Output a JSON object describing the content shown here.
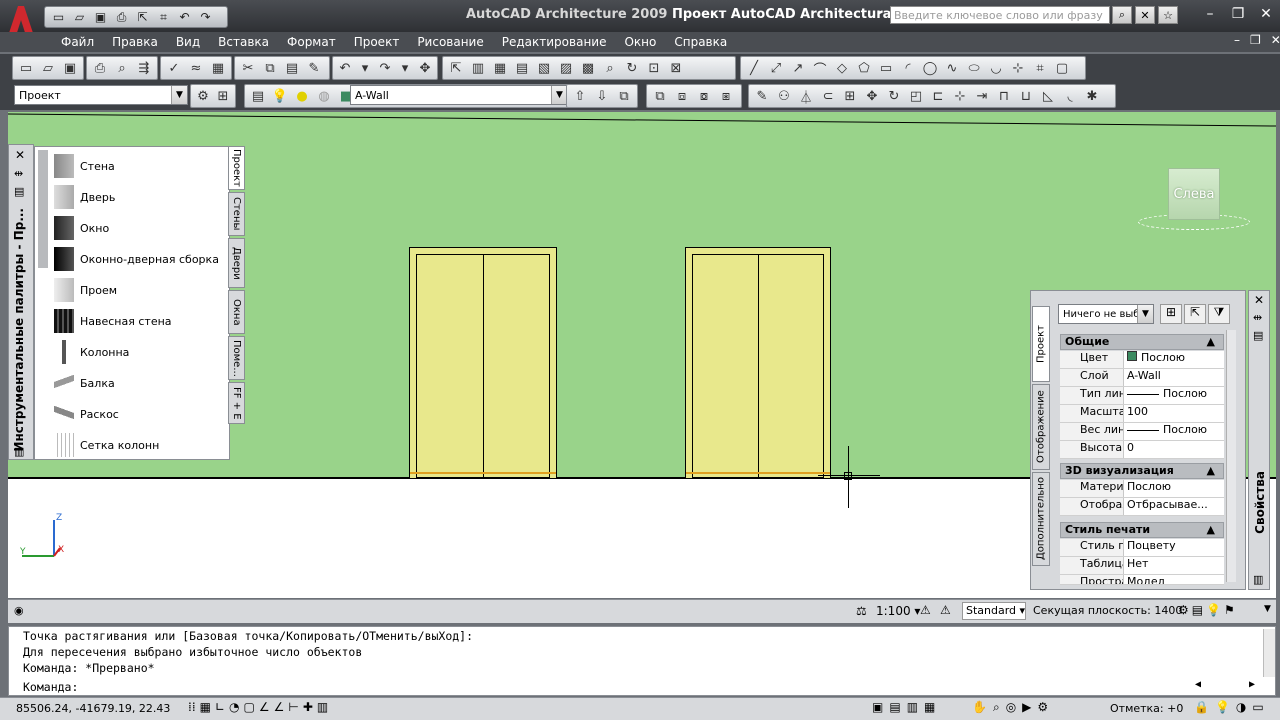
{
  "title_bar": {
    "app_name": "AutoCAD Architecture 2009",
    "document": "Проект AutoCAD Architectural",
    "search_placeholder": "Введите ключевое слово или фразу"
  },
  "menu": [
    "Файл",
    "Правка",
    "Вид",
    "Вставка",
    "Формат",
    "Проект",
    "Рисование",
    "Редактирование",
    "Окно",
    "Справка"
  ],
  "toolbar2": {
    "workspace": "Проект",
    "layer": "A-Wall"
  },
  "viewcube": {
    "label": "Слева"
  },
  "tool_palette": {
    "title": "Инструментальные палитры - Пр...",
    "items": [
      "Стена",
      "Дверь",
      "Окно",
      "Оконно-дверная сборка",
      "Проем",
      "Навесная стена",
      "Колонна",
      "Балка",
      "Раскос",
      "Сетка колонн"
    ],
    "tabs": [
      "Проект",
      "Стены",
      "Двери",
      "Окна",
      "Поме...",
      "FF + E"
    ]
  },
  "properties": {
    "title": "Свойства",
    "selection": "Ничего не выб",
    "tabs": [
      "Проект",
      "Отображение",
      "Дополнительно"
    ],
    "sections": [
      {
        "name": "Общие",
        "rows": [
          {
            "k": "Цвет",
            "v": "Послою"
          },
          {
            "k": "Слой",
            "v": "A-Wall"
          },
          {
            "k": "Тип линий",
            "v": "Послою"
          },
          {
            "k": "Масштаб...",
            "v": "100"
          },
          {
            "k": "Вес линий",
            "v": "Послою"
          },
          {
            "k": "Высота",
            "v": "0"
          }
        ]
      },
      {
        "name": "3D визуализация",
        "rows": [
          {
            "k": "Материал",
            "v": "Послою"
          },
          {
            "k": "Отображ...",
            "v": "Отбрасывае..."
          }
        ]
      },
      {
        "name": "Стиль печати",
        "rows": [
          {
            "k": "Стиль пе...",
            "v": "Поцвету"
          },
          {
            "k": "Таблица ...",
            "v": "Нет"
          },
          {
            "k": "Простра...",
            "v": "Модел"
          }
        ]
      }
    ]
  },
  "status_upper": {
    "scale": "1:100",
    "style": "Standard",
    "cut_plane_label": "Секущая плоскость:",
    "cut_plane_value": "1400"
  },
  "command_lines": [
    "Точка растягивания или [Базовая точка/Копировать/ОТменить/выХод]:",
    "Для пересечения выбрано избыточное число объектов",
    "Команда: *Прервано*",
    "Команда:"
  ],
  "status_lower": {
    "coords": "85506.24, -41679.19, 22.43",
    "elevation_label": "Отметка: +0"
  }
}
